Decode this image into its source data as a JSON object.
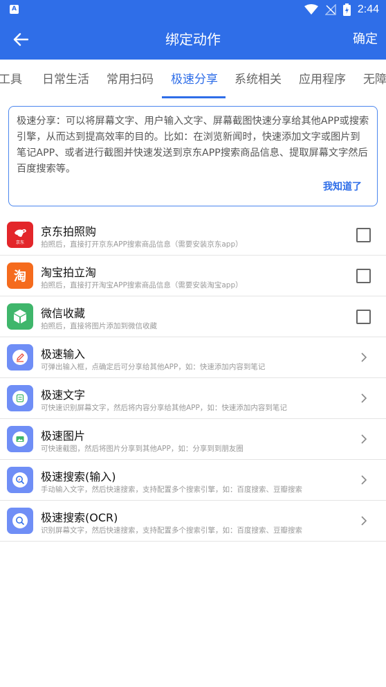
{
  "status_bar": {
    "time": "2:44",
    "left_icon_letter": "A"
  },
  "app_bar": {
    "title": "绑定动作",
    "confirm_label": "确定"
  },
  "tabs": [
    {
      "label": "工具"
    },
    {
      "label": "日常生活"
    },
    {
      "label": "常用扫码"
    },
    {
      "label": "极速分享",
      "active": true
    },
    {
      "label": "系统相关"
    },
    {
      "label": "应用程序"
    },
    {
      "label": "无障"
    }
  ],
  "info": {
    "text": "极速分享：可以将屏幕文字、用户输入文字、屏幕截图快速分享给其他APP或搜索引擎，从而达到提高效率的目的。比如：在浏览新闻时，快速添加文字或图片到笔记APP、或者进行截图并快速发送到京东APP搜索商品信息、提取屏幕文字然后百度搜索等。",
    "ok_label": "我知道了"
  },
  "items": [
    {
      "title": "京东拍照购",
      "desc": "拍照后，直接打开京东APP搜索商品信息（需要安装京东app）",
      "icon": "jd-icon",
      "icon_text": "京东",
      "accessory": "checkbox",
      "checked": false
    },
    {
      "title": "淘宝拍立淘",
      "desc": "拍照后，直接打开淘宝APP搜索商品信息（需要安装淘宝app）",
      "icon": "taobao-icon",
      "icon_text": "淘",
      "accessory": "checkbox",
      "checked": false
    },
    {
      "title": "微信收藏",
      "desc": "拍照后，直接将图片添加到微信收藏",
      "icon": "wechat-favorite-icon",
      "accessory": "checkbox",
      "checked": false
    },
    {
      "title": "极速输入",
      "desc": "可弹出输入框，点确定后可分享给其他APP，如：快速添加内容到笔记",
      "icon": "pencil-icon",
      "accessory": "chevron"
    },
    {
      "title": "极速文字",
      "desc": "可快速识别屏幕文字，然后将内容分享给其他APP，如：快速添加内容到笔记",
      "icon": "text-recognize-icon",
      "accessory": "chevron"
    },
    {
      "title": "极速图片",
      "desc": "可快速截图，然后将图片分享到其他APP，如：分享到到朋友圈",
      "icon": "picture-icon",
      "accessory": "chevron"
    },
    {
      "title": "极速搜索(输入)",
      "desc": "手动输入文字，然后快速搜索，支持配置多个搜索引擎，如：百度搜索、豆瓣搜索",
      "icon": "search-input-icon",
      "accessory": "chevron"
    },
    {
      "title": "极速搜索(OCR)",
      "desc": "识别屏幕文字，然后快速搜索，支持配置多个搜索引擎，如：百度搜索、豆瓣搜索",
      "icon": "search-ocr-icon",
      "accessory": "chevron"
    }
  ],
  "colors": {
    "primary": "#2f6ee8",
    "jd": "#e3262a",
    "taobao": "#f56b1d",
    "wechat": "#3fb66b",
    "feature": "#6f8ef6"
  }
}
